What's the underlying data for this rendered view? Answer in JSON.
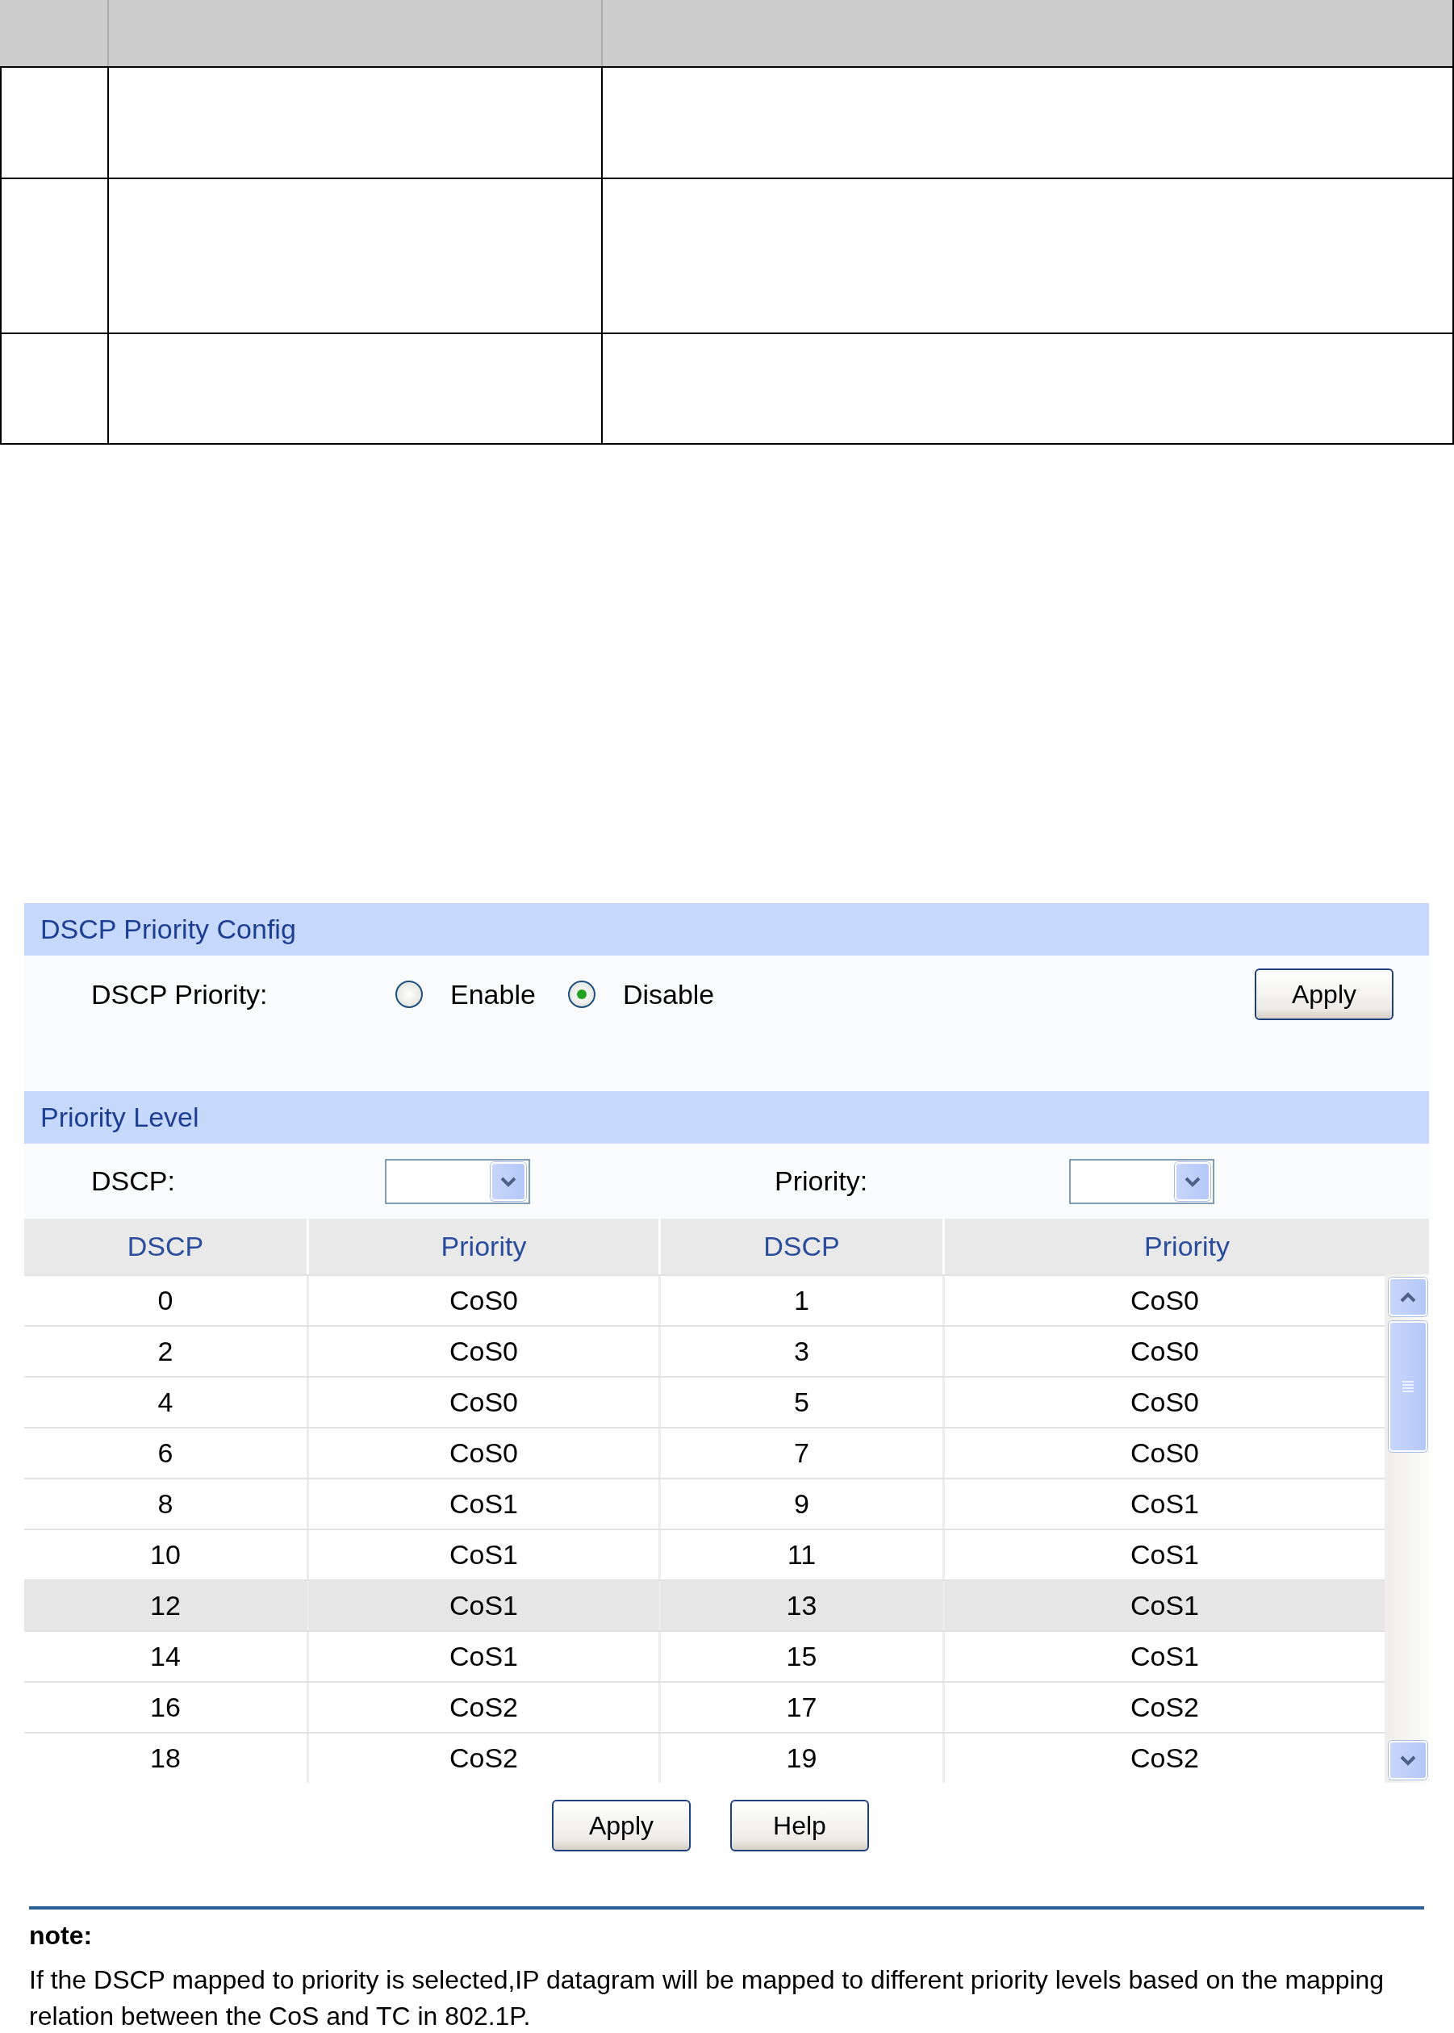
{
  "config": {
    "title": "DSCP Priority Config",
    "field_label": "DSCP Priority:",
    "options": [
      {
        "label": "Enable",
        "selected": false
      },
      {
        "label": "Disable",
        "selected": true
      }
    ],
    "apply_button": "Apply"
  },
  "priority_level": {
    "title": "Priority Level",
    "dscp_label": "DSCP:",
    "priority_label": "Priority:",
    "table": {
      "columns": [
        "DSCP",
        "Priority",
        "DSCP",
        "Priority"
      ],
      "rows": [
        {
          "cells": [
            "0",
            "CoS0",
            "1",
            "CoS0"
          ],
          "selected": false
        },
        {
          "cells": [
            "2",
            "CoS0",
            "3",
            "CoS0"
          ],
          "selected": false
        },
        {
          "cells": [
            "4",
            "CoS0",
            "5",
            "CoS0"
          ],
          "selected": false
        },
        {
          "cells": [
            "6",
            "CoS0",
            "7",
            "CoS0"
          ],
          "selected": false
        },
        {
          "cells": [
            "8",
            "CoS1",
            "9",
            "CoS1"
          ],
          "selected": false
        },
        {
          "cells": [
            "10",
            "CoS1",
            "11",
            "CoS1"
          ],
          "selected": false
        },
        {
          "cells": [
            "12",
            "CoS1",
            "13",
            "CoS1"
          ],
          "selected": true
        },
        {
          "cells": [
            "14",
            "CoS1",
            "15",
            "CoS1"
          ],
          "selected": false
        },
        {
          "cells": [
            "16",
            "CoS2",
            "17",
            "CoS2"
          ],
          "selected": false
        },
        {
          "cells": [
            "18",
            "CoS2",
            "19",
            "CoS2"
          ],
          "selected": false
        }
      ]
    },
    "buttons": [
      "Apply",
      "Help"
    ]
  },
  "note": {
    "title": "note:",
    "text": "If the DSCP mapped to priority is selected,IP datagram will be mapped to different priority levels based on the mapping relation between the CoS and TC in 802.1P."
  }
}
